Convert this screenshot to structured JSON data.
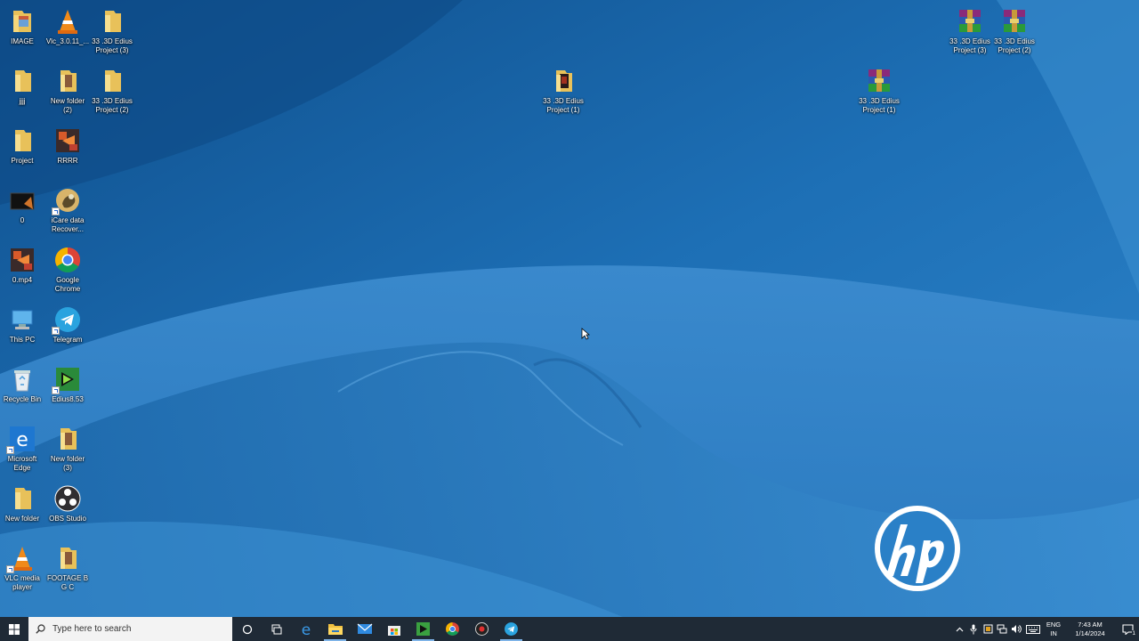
{
  "desktop_icons": [
    {
      "label": "IMAGE"
    },
    {
      "label": "Vlc_3.0.11_..."
    },
    {
      "label": "33 .3D Edius Project (3)"
    },
    {
      "label": "jjjj"
    },
    {
      "label": "New folder (2)"
    },
    {
      "label": "33 .3D Edius Project (2)"
    },
    {
      "label": "Project"
    },
    {
      "label": "RRRR"
    },
    {
      "label": "0"
    },
    {
      "label": "iCare data Recover..."
    },
    {
      "label": "0.mp4"
    },
    {
      "label": "Google Chrome"
    },
    {
      "label": "This PC"
    },
    {
      "label": "Telegram"
    },
    {
      "label": "Recycle Bin"
    },
    {
      "label": "Edius8.53"
    },
    {
      "label": "Microsoft Edge"
    },
    {
      "label": "New folder (3)"
    },
    {
      "label": "New folder"
    },
    {
      "label": "OBS Studio"
    },
    {
      "label": "VLC media player"
    },
    {
      "label": "FOOTAGE B G C"
    },
    {
      "label": "33 .3D Edius Project (1)"
    },
    {
      "label": "33 .3D Edius Project (1)"
    },
    {
      "label": "33 .3D Edius Project (3)"
    },
    {
      "label": "33 .3D Edius Project (2)"
    }
  ],
  "wallpaper": {
    "brand_logo": "hp",
    "colors": {
      "base": "#1a64a6",
      "light": "#3d8ccf",
      "dark": "#0f4f8c"
    }
  },
  "taskbar": {
    "search_placeholder": "Type here to search",
    "lang_line1": "ENG",
    "lang_line2": "IN",
    "time": "7:43 AM",
    "date": "1/14/2024",
    "notification_count": "1"
  }
}
